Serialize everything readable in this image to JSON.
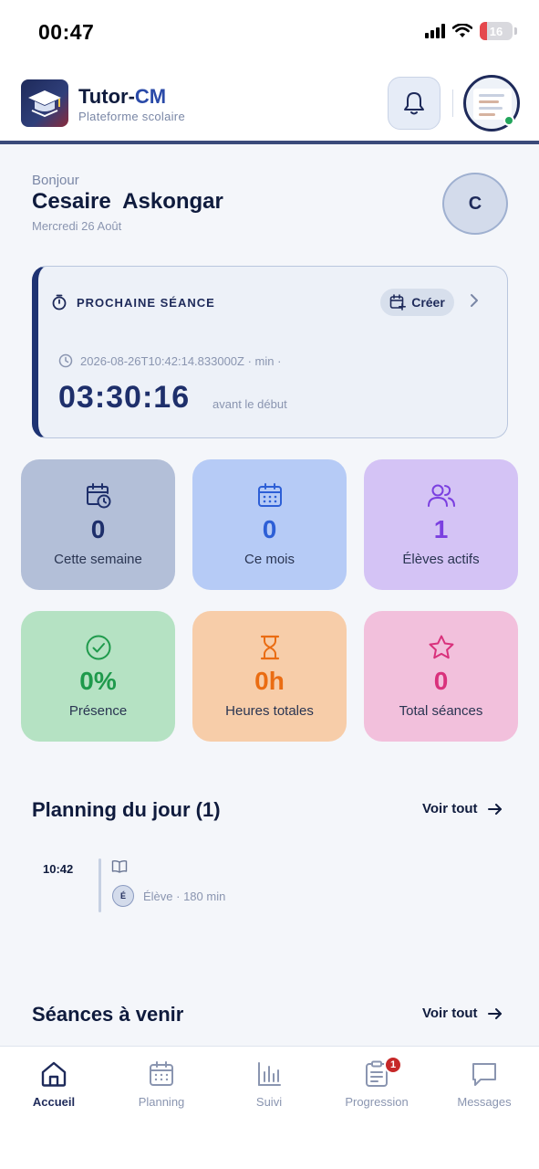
{
  "status_bar": {
    "time": "00:47",
    "battery": "16"
  },
  "header": {
    "brand_main": "Tutor-",
    "brand_accent": "CM",
    "subtitle": "Plateforme scolaire"
  },
  "greeting": {
    "hello": "Bonjour",
    "name": "Cesaire  Askongar",
    "date": "Mercredi 26 Août",
    "initial": "C"
  },
  "next_session": {
    "title": "PROCHAINE SÉANCE",
    "create_label": "Créer",
    "meta": "2026-08-26T10:42:14.833000Z  ·  min  ·",
    "countdown": "03:30:16",
    "countdown_label": "avant le début"
  },
  "stats": [
    {
      "value": "0",
      "label": "Cette semaine",
      "icon": "calendar-clock-icon",
      "bg": "#b3bfd8",
      "color": "#1e2f6b"
    },
    {
      "value": "0",
      "label": "Ce mois",
      "icon": "calendar-icon",
      "bg": "#b6cbf6",
      "color": "#2d5fd6"
    },
    {
      "value": "1",
      "label": "Élèves actifs",
      "icon": "users-icon",
      "bg": "#d4c3f5",
      "color": "#7b3fe0"
    },
    {
      "value": "0%",
      "label": "Présence",
      "icon": "check-circle-icon",
      "bg": "#b5e2c3",
      "color": "#1f9a4c"
    },
    {
      "value": "0h",
      "label": "Heures totales",
      "icon": "hourglass-icon",
      "bg": "#f7cda9",
      "color": "#ea6c12"
    },
    {
      "value": "0",
      "label": "Total séances",
      "icon": "star-icon",
      "bg": "#f2c0dc",
      "color": "#d9317c"
    }
  ],
  "planning": {
    "title": "Planning du jour (1)",
    "see_all": "Voir tout",
    "item": {
      "time": "10:42",
      "badge": "É",
      "info": "Élève · 180 min"
    }
  },
  "upcoming": {
    "title": "Séances à venir",
    "see_all": "Voir tout"
  },
  "tabs": [
    {
      "label": "Accueil",
      "icon": "home-icon"
    },
    {
      "label": "Planning",
      "icon": "calendar-icon"
    },
    {
      "label": "Suivi",
      "icon": "chart-icon"
    },
    {
      "label": "Progression",
      "icon": "clipboard-icon",
      "badge": "1"
    },
    {
      "label": "Messages",
      "icon": "message-icon"
    }
  ]
}
